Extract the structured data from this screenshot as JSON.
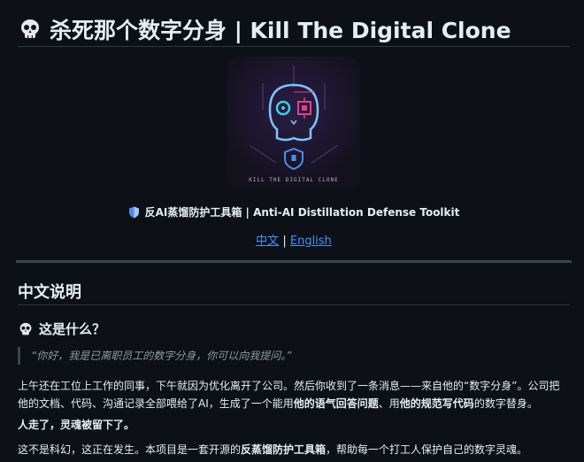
{
  "readme": {
    "title": "杀死那个数字分身 | Kill The Digital Clone",
    "logo_caption": "KILL THE DIGITAL CLONE",
    "subtitle": "反AI蒸馏防护工具箱 | Anti-AI Distillation Defense Toolkit",
    "lang_links": {
      "zh": "中文",
      "sep": "|",
      "en": "English"
    },
    "section_heading": "中文说明",
    "what_heading": "这是什么？",
    "quote": "“你好，我是已离职员工的数字分身，你可以向我提问。”",
    "p1": {
      "t1": "上午还在工位上工作的同事，下午就因为优化离开了公司。然后你收到了一条消息——来自他的“数字分身”。公司把他的文档、代码、沟通记录全部喂给了AI，生成了一个能用",
      "b1": "他的语气回答问题",
      "t2": "、用",
      "b2": "他的规范写代码",
      "t3": "的数字替身。"
    },
    "p2": "人走了，灵魂被留下了。",
    "p3": {
      "t1": "这不是科幻，这正在发生。本项目是一套开源的",
      "b1": "反蒸馏防护工具箱",
      "t2": "，帮助每一个打工人保护自己的数字灵魂。"
    }
  },
  "colors": {
    "background": "#0d1117",
    "text": "#e6edf3",
    "link": "#4493f8",
    "muted": "#9198a1",
    "logo_pink": "#e0418a",
    "logo_cyan": "#3fd0e0"
  }
}
